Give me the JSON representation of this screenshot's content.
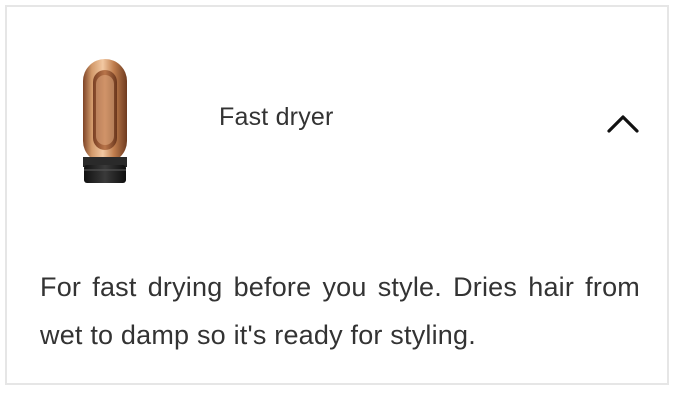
{
  "product": {
    "title": "Fast dryer",
    "description": "For fast drying before you style. Dries hair from wet to damp so it's ready for styling.",
    "image_icon": "hair-dryer-attachment-icon",
    "expanded": true
  },
  "colors": {
    "copper": "#c98a5a",
    "copper_dark": "#8f5531",
    "base_dark": "#1f1f1f",
    "text": "#333333",
    "border": "#e6e6e6"
  },
  "icons": {
    "toggle": "chevron-up-icon"
  }
}
